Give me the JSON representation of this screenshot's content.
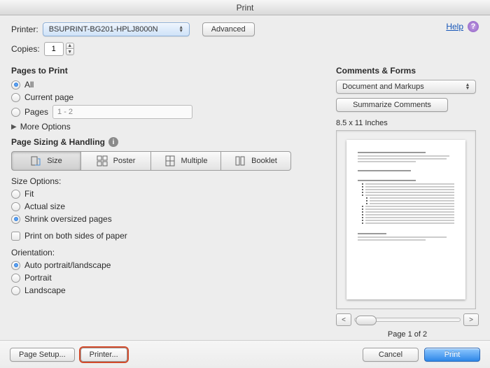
{
  "window": {
    "title": "Print"
  },
  "help": {
    "label": "Help",
    "icon_glyph": "?"
  },
  "printer": {
    "label": "Printer:",
    "selected": "BSUPRINT-BG201-HPLJ8000N",
    "advanced": "Advanced"
  },
  "copies": {
    "label": "Copies:",
    "value": "1"
  },
  "pages_to_print": {
    "title": "Pages to Print",
    "all": "All",
    "current": "Current page",
    "pages": "Pages",
    "pages_value": "1 - 2",
    "more_options": "More Options",
    "selected": "all"
  },
  "sizing": {
    "title": "Page Sizing & Handling",
    "tabs": {
      "size": "Size",
      "poster": "Poster",
      "multiple": "Multiple",
      "booklet": "Booklet"
    },
    "active_tab": "size",
    "size_options": {
      "title": "Size Options:",
      "fit": "Fit",
      "actual": "Actual size",
      "shrink": "Shrink oversized pages",
      "selected": "shrink"
    },
    "duplex": "Print on both sides of paper",
    "orientation": {
      "title": "Orientation:",
      "auto": "Auto portrait/landscape",
      "portrait": "Portrait",
      "landscape": "Landscape",
      "selected": "auto"
    }
  },
  "comments": {
    "title": "Comments & Forms",
    "selected": "Document and Markups",
    "summarize": "Summarize Comments"
  },
  "preview": {
    "dimensions": "8.5 x 11 Inches",
    "page_indicator": "Page 1 of 2"
  },
  "footer": {
    "page_setup": "Page Setup...",
    "printer": "Printer...",
    "cancel": "Cancel",
    "print": "Print"
  }
}
